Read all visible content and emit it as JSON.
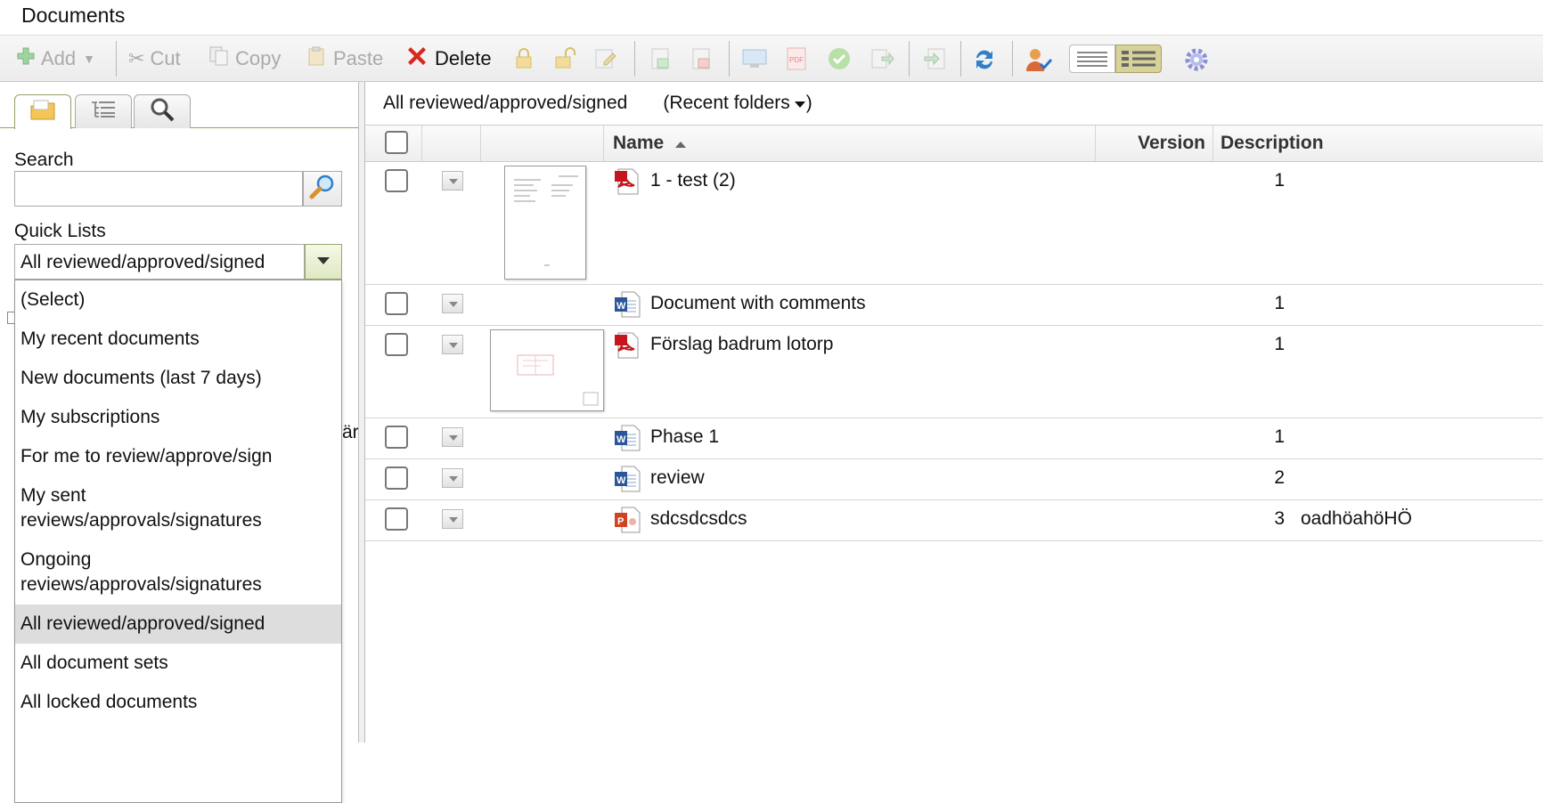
{
  "app": {
    "title": "Documents"
  },
  "toolbar": {
    "add_label": "Add",
    "cut_label": "Cut",
    "copy_label": "Copy",
    "paste_label": "Paste",
    "delete_label": "Delete"
  },
  "sidebar": {
    "tabs": [
      "folders-tab",
      "list-tab",
      "search-tab"
    ],
    "search_label": "Search",
    "search_value": "",
    "quicklists_label": "Quick Lists",
    "quicklists_selected": "All reviewed/approved/signed",
    "options": [
      {
        "label": "(Select)",
        "lines": 1,
        "selected": false
      },
      {
        "label": "My recent documents",
        "lines": 1,
        "selected": false
      },
      {
        "label": "New documents (last 7 days)",
        "lines": 1,
        "selected": false
      },
      {
        "label": "My subscriptions",
        "lines": 1,
        "selected": false
      },
      {
        "label": "For me to review/approve/sign",
        "lines": 1,
        "selected": false
      },
      {
        "label": "My sent reviews/approvals/signatures",
        "lines": 2,
        "selected": false
      },
      {
        "label": "Ongoing reviews/approvals/signatures",
        "lines": 2,
        "selected": false
      },
      {
        "label": "All reviewed/approved/signed",
        "lines": 1,
        "selected": true
      },
      {
        "label": "All document sets",
        "lines": 1,
        "selected": false
      },
      {
        "label": "All locked documents",
        "lines": 1,
        "selected": false
      }
    ],
    "peek_text": "är"
  },
  "main": {
    "current_list": "All reviewed/approved/signed",
    "recent_folders": "(Recent folders",
    "columns": {
      "name": "Name",
      "version": "Version",
      "description": "Description"
    },
    "rows": [
      {
        "name": "1 - test (2)",
        "type": "pdf",
        "version": "1",
        "description": "",
        "thumb": "page"
      },
      {
        "name": "Document with comments",
        "type": "word",
        "version": "1",
        "description": "",
        "thumb": ""
      },
      {
        "name": "Förslag badrum lotorp",
        "type": "pdf",
        "version": "1",
        "description": "",
        "thumb": "plan"
      },
      {
        "name": "Phase 1",
        "type": "word",
        "version": "1",
        "description": "",
        "thumb": ""
      },
      {
        "name": "review",
        "type": "word",
        "version": "2",
        "description": "",
        "thumb": ""
      },
      {
        "name": "sdcsdcsdcs",
        "type": "powerpoint",
        "version": "3",
        "description": "oadhöahöHÖ",
        "thumb": ""
      }
    ]
  },
  "colors": {
    "pdf": "#c4161c",
    "word": "#2b579a",
    "powerpoint": "#d04423",
    "delete": "#d9261c",
    "selected_row": "#dddddd"
  }
}
